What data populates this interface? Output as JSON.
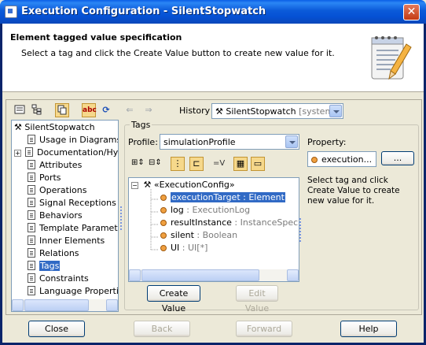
{
  "window": {
    "title": "Execution Configuration - SilentStopwatch",
    "close_glyph": "✕"
  },
  "header": {
    "title": "Element tagged value specification",
    "description": "Select a tag and click the Create Value button to create new value for it."
  },
  "toolbar": {
    "history_label": "History :",
    "history_value": "SilentStopwatch",
    "history_suffix": "[system]",
    "abc_label": "abc",
    "icons": [
      "list-view-icon",
      "tree-view-icon",
      "copy-icon",
      "abc-sort-icon",
      "refresh-icon",
      "back-arrow-icon",
      "forward-arrow-icon"
    ]
  },
  "tree": {
    "root": "SilentStopwatch",
    "items": [
      {
        "label": "Usage in Diagrams"
      },
      {
        "label": "Documentation/Hyp"
      },
      {
        "label": "Attributes"
      },
      {
        "label": "Ports"
      },
      {
        "label": "Operations"
      },
      {
        "label": "Signal Receptions"
      },
      {
        "label": "Behaviors"
      },
      {
        "label": "Template Paramete"
      },
      {
        "label": "Inner Elements"
      },
      {
        "label": "Relations"
      },
      {
        "label": "Tags",
        "selected": true
      },
      {
        "label": "Constraints"
      },
      {
        "label": "Language Propertie"
      }
    ]
  },
  "tags": {
    "group_label": "Tags",
    "profile_label": "Profile:",
    "profile_value": "simulationProfile",
    "property_label": "Property:",
    "property_value": "execution...",
    "ellipsis_label": "...",
    "stereotype": "«ExecutionConfig»",
    "entries": [
      {
        "name": "executionTarget",
        "type": " : Element",
        "selected": true
      },
      {
        "name": "log",
        "type": " : ExecutionLog"
      },
      {
        "name": "resultInstance",
        "type": " : InstanceSpecific"
      },
      {
        "name": "silent",
        "type": " : Boolean"
      },
      {
        "name": "UI",
        "type": " : UI[*]"
      }
    ],
    "hint": "Select tag and click Create Value to create new value for it.",
    "create_value": "Create Value",
    "edit_value": "Edit Value",
    "eqv_label": "=V"
  },
  "footer": {
    "close": "Close",
    "back": "Back",
    "forward": "Forward",
    "help": "Help"
  },
  "colors": {
    "titlebar": "#0b5ad9",
    "selection": "#316ac5",
    "toolbar_active": "#f6d88b"
  }
}
